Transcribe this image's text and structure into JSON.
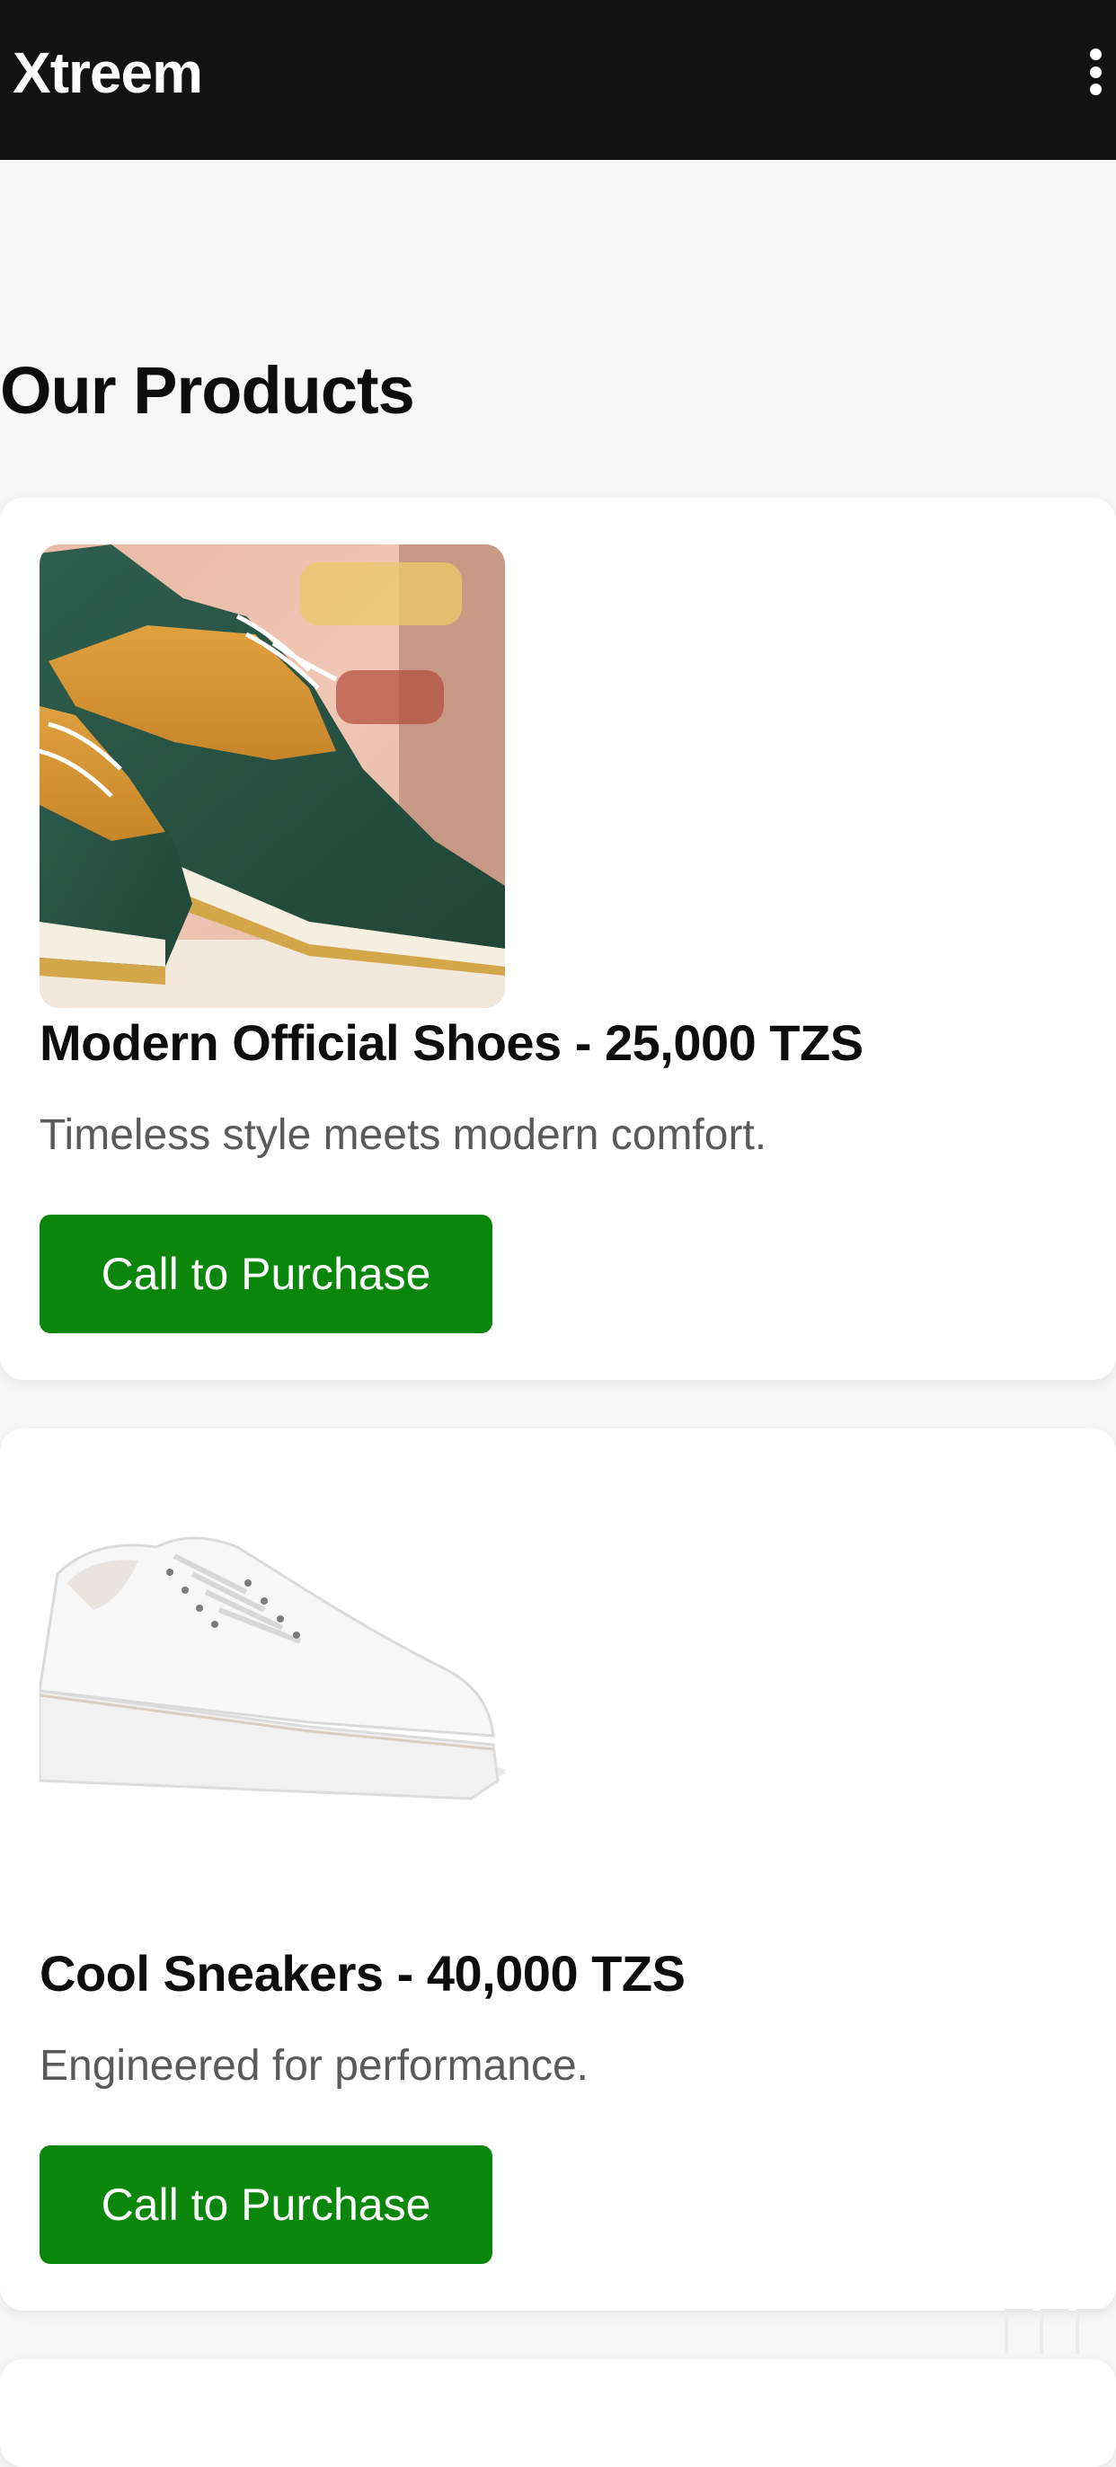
{
  "app_bar": {
    "title": "Xtreem",
    "menu_icon": "more-vertical-icon"
  },
  "page": {
    "section_title": "Our Products"
  },
  "products": [
    {
      "name": "Modern Official Shoes - 25,000 TZS",
      "description": "Timeless style meets modern comfort.",
      "button_label": "Call to Purchase",
      "image": "green-tan-oxford-shoes"
    },
    {
      "name": "Cool Sneakers - 40,000 TZS",
      "description": "Engineered for performance.",
      "button_label": "Call to Purchase",
      "image": "white-sneaker"
    }
  ],
  "colors": {
    "app_bar": "#121212",
    "button": "#0a870a",
    "background": "#f7f7f7"
  }
}
